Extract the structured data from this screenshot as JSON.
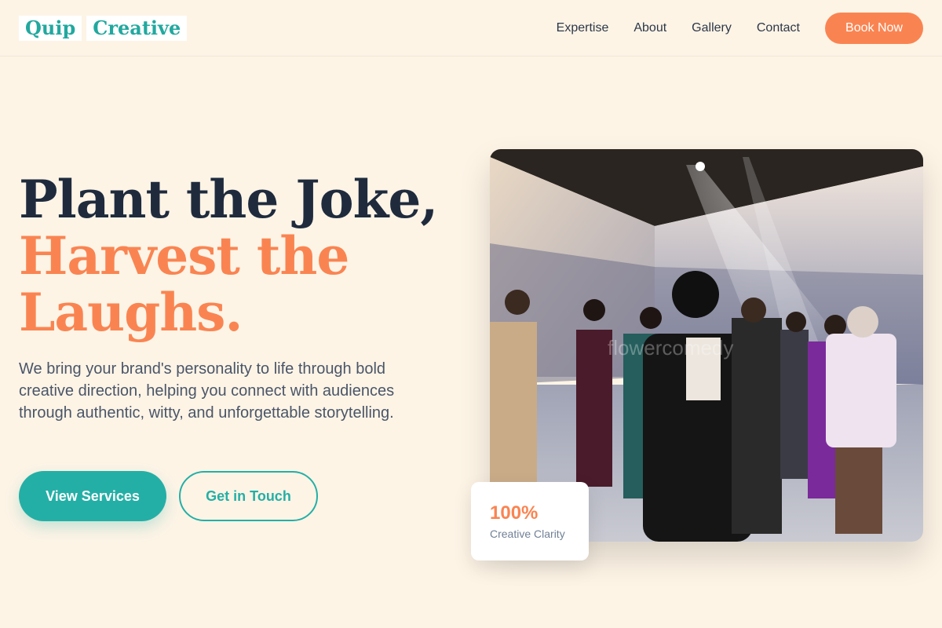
{
  "brand": {
    "word1": "Quip",
    "word2": "Creative",
    "accent": "#22a89f"
  },
  "nav": {
    "links": [
      "Expertise",
      "About",
      "Gallery",
      "Contact"
    ],
    "cta": "Book Now",
    "cta_color": "#fa8451"
  },
  "hero": {
    "title_line1": "Plant the Joke,",
    "title_line2": "Harvest the",
    "title_line3": "Laughs.",
    "description": "We bring your brand's personality to life through bold creative direction, helping you connect with audiences through authentic, witty, and unforgettable storytelling.",
    "primary_button": "View Services",
    "secondary_button": "Get in Touch"
  },
  "stat": {
    "value": "100%",
    "label": "Creative Clarity"
  },
  "image": {
    "watermark": "flowercomedy"
  },
  "colors": {
    "background": "#fdf4e6",
    "primary": "#24afa6",
    "accent": "#fa8451",
    "heading": "#1f2b3d"
  }
}
